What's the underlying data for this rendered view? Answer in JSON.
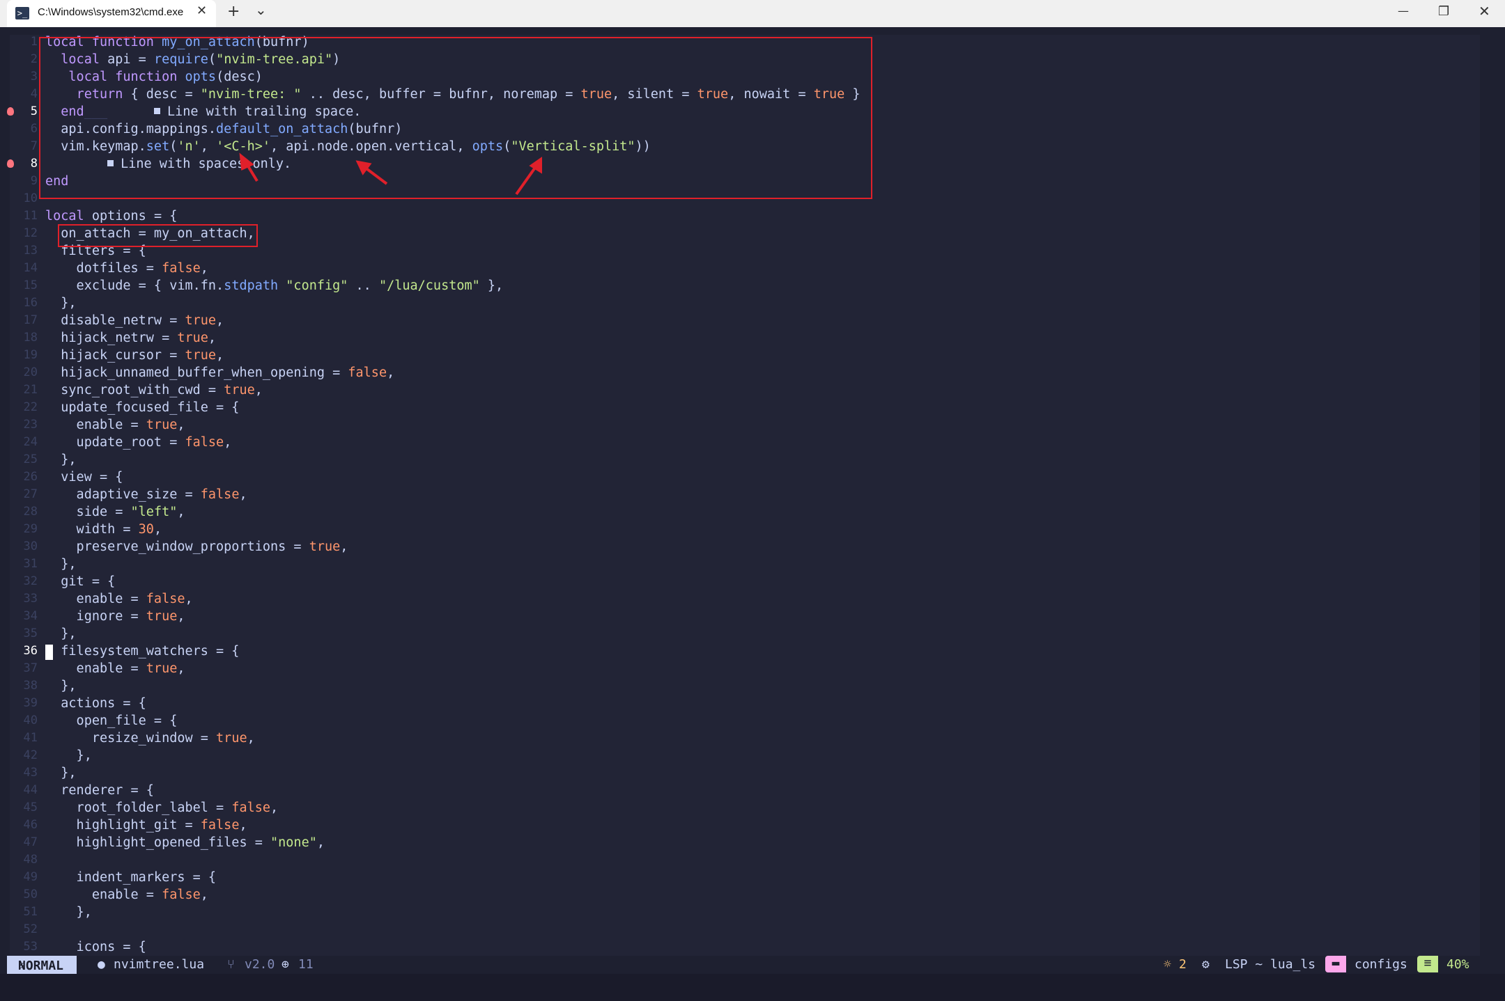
{
  "window": {
    "tab_title": "C:\\Windows\\system32\\cmd.exe",
    "tab_icon": "terminal-icon",
    "new_tab": "+",
    "dropdown": "⌄",
    "minimize": "—",
    "restore": "❐",
    "close": "✕"
  },
  "editor": {
    "lines": [
      {
        "n": "1"
      },
      {
        "n": "2"
      },
      {
        "n": "3"
      },
      {
        "n": "4"
      },
      {
        "n": "5"
      },
      {
        "n": "6"
      },
      {
        "n": "7"
      },
      {
        "n": "8"
      },
      {
        "n": "9"
      },
      {
        "n": "10"
      },
      {
        "n": "11"
      },
      {
        "n": "12"
      },
      {
        "n": "13"
      },
      {
        "n": "14"
      },
      {
        "n": "15"
      },
      {
        "n": "16"
      },
      {
        "n": "17"
      },
      {
        "n": "18"
      },
      {
        "n": "19"
      },
      {
        "n": "20"
      },
      {
        "n": "21"
      },
      {
        "n": "22"
      },
      {
        "n": "23"
      },
      {
        "n": "24"
      },
      {
        "n": "25"
      },
      {
        "n": "26"
      },
      {
        "n": "27"
      },
      {
        "n": "28"
      },
      {
        "n": "29"
      },
      {
        "n": "30"
      },
      {
        "n": "31"
      },
      {
        "n": "32"
      },
      {
        "n": "33"
      },
      {
        "n": "34"
      },
      {
        "n": "35"
      },
      {
        "n": "36"
      },
      {
        "n": "37"
      },
      {
        "n": "38"
      },
      {
        "n": "39"
      },
      {
        "n": "40"
      },
      {
        "n": "41"
      },
      {
        "n": "42"
      },
      {
        "n": "43"
      },
      {
        "n": "44"
      },
      {
        "n": "45"
      },
      {
        "n": "46"
      },
      {
        "n": "47"
      },
      {
        "n": "48"
      },
      {
        "n": "49"
      },
      {
        "n": "50"
      },
      {
        "n": "51"
      },
      {
        "n": "52"
      },
      {
        "n": "53"
      }
    ],
    "code": {
      "l1": [
        "local",
        " ",
        "function",
        " ",
        "my_on_attach",
        "(bufnr)"
      ],
      "l2": [
        "  ",
        "local",
        " api = ",
        "require",
        "(",
        "\"nvim-tree.api\"",
        ")"
      ],
      "l3": [
        "   ",
        "local",
        " ",
        "function",
        " ",
        "opts",
        "(desc)"
      ],
      "l4": [
        "    ",
        "return",
        " { desc = ",
        "\"nvim-tree: \"",
        " .. desc, buffer = bufnr, noremap = ",
        "true",
        ", silent = ",
        "true",
        ", nowait = ",
        "true",
        " }"
      ],
      "l5": [
        "  ",
        "end",
        "___",
        "Line with trailing space."
      ],
      "l6": [
        "  api.config.mappings.",
        "default_on_attach",
        "(bufnr)"
      ],
      "l7": [
        "  vim.keymap.",
        "set",
        "(",
        "'n'",
        ", ",
        "'<C-h>'",
        ", api.node.open.vertical, ",
        "opts",
        "(",
        "\"Vertical-split\"",
        "))"
      ],
      "l8": [
        "Line with spaces only."
      ],
      "l9": [
        "end"
      ],
      "l11": [
        "local",
        " options = {"
      ],
      "l12": [
        "  on_attach = my_on_attach,"
      ],
      "l13": [
        "  filters = {"
      ],
      "l14": [
        "    dotfiles = ",
        "false",
        ","
      ],
      "l15": [
        "    exclude = { vim.fn.",
        "stdpath",
        " ",
        "\"config\"",
        " .. ",
        "\"/lua/custom\"",
        " },"
      ],
      "l16": [
        "  },"
      ],
      "l17": [
        "  disable_netrw = ",
        "true",
        ","
      ],
      "l18": [
        "  hijack_netrw = ",
        "true",
        ","
      ],
      "l19": [
        "  hijack_cursor = ",
        "true",
        ","
      ],
      "l20": [
        "  hijack_unnamed_buffer_when_opening = ",
        "false",
        ","
      ],
      "l21": [
        "  sync_root_with_cwd = ",
        "true",
        ","
      ],
      "l22": [
        "  update_focused_file = {"
      ],
      "l23": [
        "    enable = ",
        "true",
        ","
      ],
      "l24": [
        "    update_root = ",
        "false",
        ","
      ],
      "l25": [
        "  },"
      ],
      "l26": [
        "  view = {"
      ],
      "l27": [
        "    adaptive_size = ",
        "false",
        ","
      ],
      "l28": [
        "    side = ",
        "\"left\"",
        ","
      ],
      "l29": [
        "    width = ",
        "30",
        ","
      ],
      "l30": [
        "    preserve_window_proportions = ",
        "true",
        ","
      ],
      "l31": [
        "  },"
      ],
      "l32": [
        "  git = {"
      ],
      "l33": [
        "    enable = ",
        "false",
        ","
      ],
      "l34": [
        "    ignore = ",
        "true",
        ","
      ],
      "l35": [
        "  },"
      ],
      "l36": [
        "  filesystem_watchers = {"
      ],
      "l37": [
        "    enable = ",
        "true",
        ","
      ],
      "l38": [
        "  },"
      ],
      "l39": [
        "  actions = {"
      ],
      "l40": [
        "    open_file = {"
      ],
      "l41": [
        "      resize_window = ",
        "true",
        ","
      ],
      "l42": [
        "    },"
      ],
      "l43": [
        "  },"
      ],
      "l44": [
        "  renderer = {"
      ],
      "l45": [
        "    root_folder_label = ",
        "false",
        ","
      ],
      "l46": [
        "    highlight_git = ",
        "false",
        ","
      ],
      "l47": [
        "    highlight_opened_files = ",
        "\"none\"",
        ","
      ],
      "l49": [
        "    indent_markers = {"
      ],
      "l50": [
        "      enable = ",
        "false",
        ","
      ],
      "l51": [
        "    },"
      ],
      "l53": [
        "    icons = {"
      ]
    },
    "current_line": "36"
  },
  "statusline": {
    "mode": "NORMAL",
    "mode_icon": "vim-icon",
    "file_icon": "lua-file-icon",
    "filename": "nvimtree.lua",
    "branch_icon": "git-branch-icon",
    "branch": "v2.0",
    "changes_icon": "plus-circle-icon",
    "changes": "11",
    "hints_icon": "lightbulb-icon",
    "hints": "2",
    "lsp_icon": "gears-icon",
    "lsp": "LSP ~ lua_ls",
    "folder_icon": "folder-icon",
    "folder": "configs",
    "progress_icon": "file-lines-icon",
    "progress": "40%"
  },
  "colors": {
    "background": "#222436",
    "keyword": "#c099ff",
    "function": "#82aaff",
    "string": "#c3e88d",
    "boolean": "#ff966c",
    "annotation": "#e0202a"
  }
}
